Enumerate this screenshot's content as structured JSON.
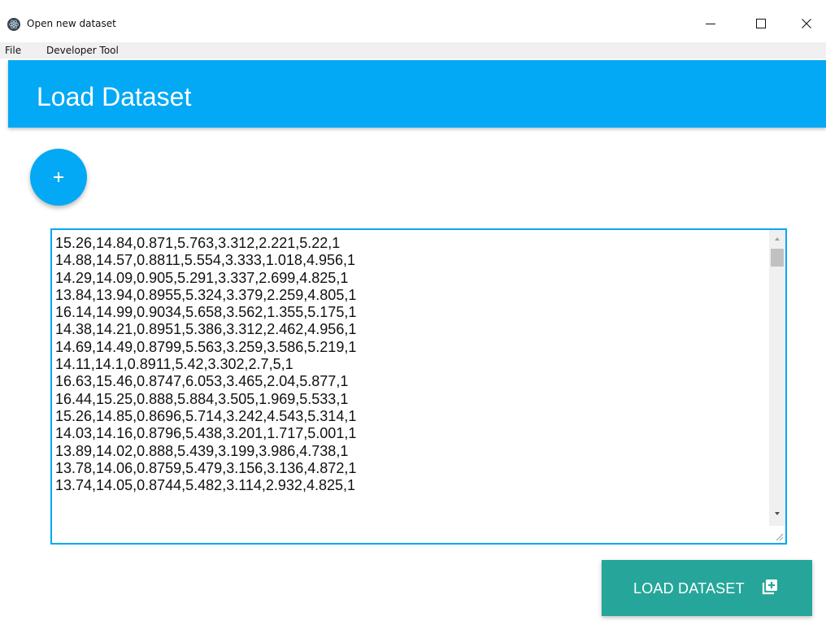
{
  "window": {
    "title": "Open new dataset",
    "controls": {
      "minimize": "minimize-icon",
      "maximize": "maximize-icon",
      "close": "close-icon"
    }
  },
  "menu": {
    "items": [
      {
        "label": "File"
      },
      {
        "label": "Developer Tool"
      }
    ]
  },
  "header": {
    "title": "Load Dataset",
    "color": "#03a9f4"
  },
  "add_button": {
    "icon": "plus-icon",
    "color": "#03a9f4"
  },
  "dataset": {
    "lines": [
      "15.26,14.84,0.871,5.763,3.312,2.221,5.22,1",
      "14.88,14.57,0.8811,5.554,3.333,1.018,4.956,1",
      "14.29,14.09,0.905,5.291,3.337,2.699,4.825,1",
      "13.84,13.94,0.8955,5.324,3.379,2.259,4.805,1",
      "16.14,14.99,0.9034,5.658,3.562,1.355,5.175,1",
      "14.38,14.21,0.8951,5.386,3.312,2.462,4.956,1",
      "14.69,14.49,0.8799,5.563,3.259,3.586,5.219,1",
      "14.11,14.1,0.8911,5.42,3.302,2.7,5,1",
      "16.63,15.46,0.8747,6.053,3.465,2.04,5.877,1",
      "16.44,15.25,0.888,5.884,3.505,1.969,5.533,1",
      "15.26,14.85,0.8696,5.714,3.242,4.543,5.314,1",
      "14.03,14.16,0.8796,5.438,3.201,1.717,5.001,1",
      "13.89,14.02,0.888,5.439,3.199,3.986,4.738,1",
      "13.78,14.06,0.8759,5.479,3.156,3.136,4.872,1",
      "13.74,14.05,0.8744,5.482,3.114,2.932,4.825,1"
    ]
  },
  "load_button": {
    "label": "LOAD DATASET",
    "icon": "library-add-icon",
    "color": "#26a69a"
  }
}
